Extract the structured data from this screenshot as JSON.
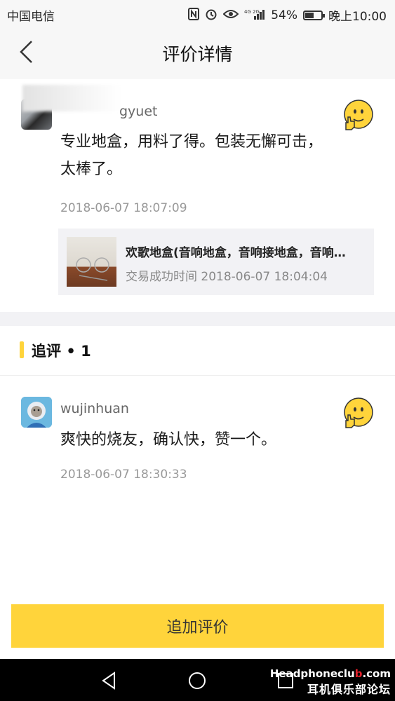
{
  "status_bar": {
    "carrier": "中国电信",
    "network": "4G 2G",
    "battery": "54%",
    "battery_level": 0.54,
    "time": "晚上10:00"
  },
  "header": {
    "title": "评价详情",
    "back_icon": "chevron-left-icon"
  },
  "review": {
    "username": "gyuet",
    "text_line1": "专业地盒，用料了得。包装无懈可击，",
    "text_line2": "太棒了。",
    "timestamp": "2018-06-07 18:07:09",
    "badge_icon": "thumbs-up-emoji-icon",
    "product": {
      "title": "欢歌地盒(音响地盒，音响接地盒，音响…",
      "trade_time": "交易成功时间 2018-06-07 18:04:04"
    }
  },
  "followup": {
    "header": "追评",
    "separator": "•",
    "count": "1",
    "username": "wujinhuan",
    "text": "爽快的烧友，确认快，赞一个。",
    "timestamp": "2018-06-07 18:30:33",
    "badge_icon": "thumbs-up-emoji-icon"
  },
  "actions": {
    "add_review_label": "追加评价"
  },
  "system_nav": {
    "back_icon": "triangle-back-icon",
    "home_icon": "circle-home-icon",
    "recents_icon": "square-recents-icon"
  },
  "watermark": {
    "line1_pre": "Hea",
    "line1_mid": "dphoneclu",
    "line1_red": "b",
    "line1_post": ".com",
    "line2": "耳机俱乐部论坛"
  }
}
